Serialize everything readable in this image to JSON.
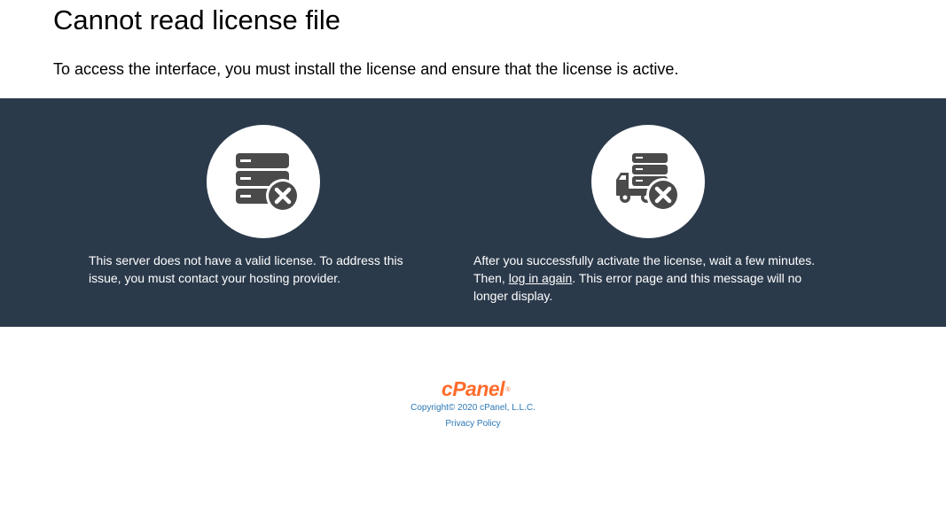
{
  "header": {
    "title": "Cannot read license file",
    "subtitle": "To access the interface, you must install the license and ensure that the license is active."
  },
  "panels": [
    {
      "icon": "server-error-icon",
      "text": "This server does not have a valid license. To address this issue, you must contact your hosting provider."
    },
    {
      "icon": "server-truck-error-icon",
      "text_before": "After you successfully activate the license, wait a few minutes. Then, ",
      "link_label": "log in again",
      "text_after": ". This error page and this message will no longer display."
    }
  ],
  "footer": {
    "logo": "cPanel",
    "logo_mark": "®",
    "copyright": "Copyright© 2020 cPanel, L.L.C.",
    "privacy_link": "Privacy Policy"
  },
  "colors": {
    "band": "#2b3a4b",
    "icon": "#4a4a4a",
    "logo": "#ff6c2c",
    "link": "#2b78b6"
  }
}
